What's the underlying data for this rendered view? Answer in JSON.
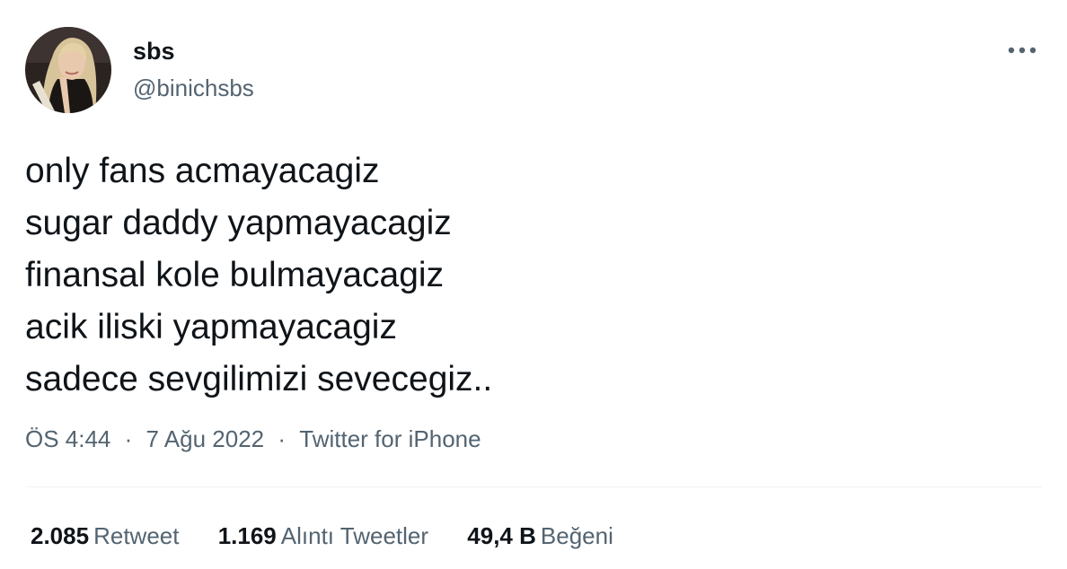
{
  "user": {
    "display_name": "sbs",
    "handle": "@binichsbs",
    "avatar_icon": "profile-photo"
  },
  "tweet": {
    "lines": [
      "only fans acmayacagiz",
      "sugar daddy yapmayacagiz",
      "finansal kole bulmayacagiz",
      "acik iliski yapmayacagiz",
      "sadece sevgilimizi sevecegiz.."
    ]
  },
  "meta": {
    "time": "ÖS 4:44",
    "date": "7 Ağu 2022",
    "source": "Twitter for iPhone",
    "separator": "·"
  },
  "stats": {
    "retweets": {
      "count": "2.085",
      "label": "Retweet"
    },
    "quotes": {
      "count": "1.169",
      "label": "Alıntı Tweetler"
    },
    "likes": {
      "count": "49,4 B",
      "label": "Beğeni"
    }
  },
  "colors": {
    "text": "#0f1419",
    "secondary": "#536471",
    "divider": "#eff3f4"
  }
}
